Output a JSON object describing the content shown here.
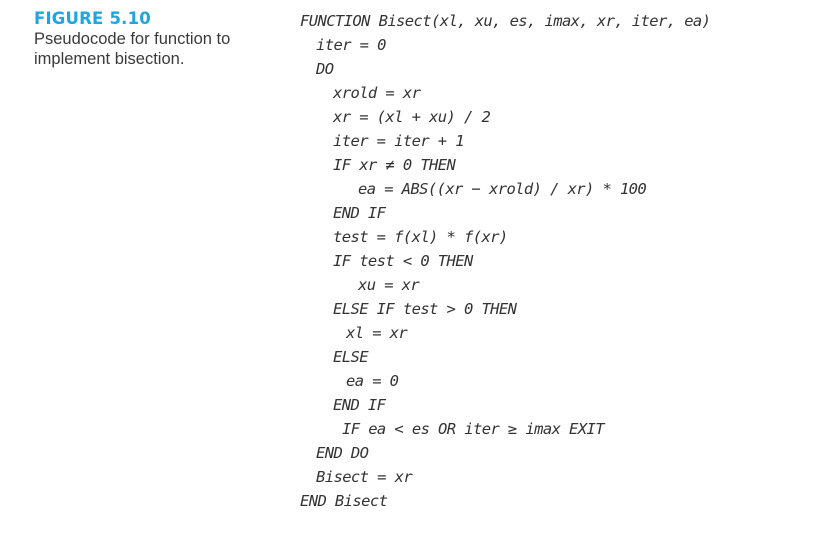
{
  "figure": {
    "label": "FIGURE 5.10",
    "caption_line1": "Pseudocode for function to",
    "caption_line2": "implement bisection.",
    "accent_color": "#1fa5e0"
  },
  "code": {
    "lines": [
      {
        "indent": 0,
        "text": "FUNCTION Bisect(xl, xu, es, imax, xr, iter, ea)"
      },
      {
        "indent": 1,
        "text": "iter = 0"
      },
      {
        "indent": 1,
        "text": "DO"
      },
      {
        "indent": 2,
        "text": "xrold = xr"
      },
      {
        "indent": 2,
        "text": "xr = (xl + xu) / 2"
      },
      {
        "indent": 2,
        "text": "iter = iter + 1"
      },
      {
        "indent": 2,
        "text": "IF xr ≠ 0 THEN"
      },
      {
        "indent": 3,
        "text": "ea = ABS((xr − xrold) / xr) * 100"
      },
      {
        "indent": 2,
        "text": "END IF"
      },
      {
        "indent": 2,
        "text": "test = f(xl) * f(xr)"
      },
      {
        "indent": 2,
        "text": "IF test < 0 THEN"
      },
      {
        "indent": 3,
        "text": "xu = xr"
      },
      {
        "indent": 2,
        "text": "ELSE IF test > 0 THEN"
      },
      {
        "indent": 2.5,
        "text": "xl = xr"
      },
      {
        "indent": 2,
        "text": "ELSE"
      },
      {
        "indent": 2.5,
        "text": "ea = 0"
      },
      {
        "indent": 2,
        "text": "END IF"
      },
      {
        "indent": 2.3,
        "text": "IF ea < es OR iter ≥ imax EXIT"
      },
      {
        "indent": 1,
        "text": "END DO"
      },
      {
        "indent": 1,
        "text": "Bisect = xr"
      },
      {
        "indent": 0,
        "text": "END Bisect"
      }
    ]
  }
}
